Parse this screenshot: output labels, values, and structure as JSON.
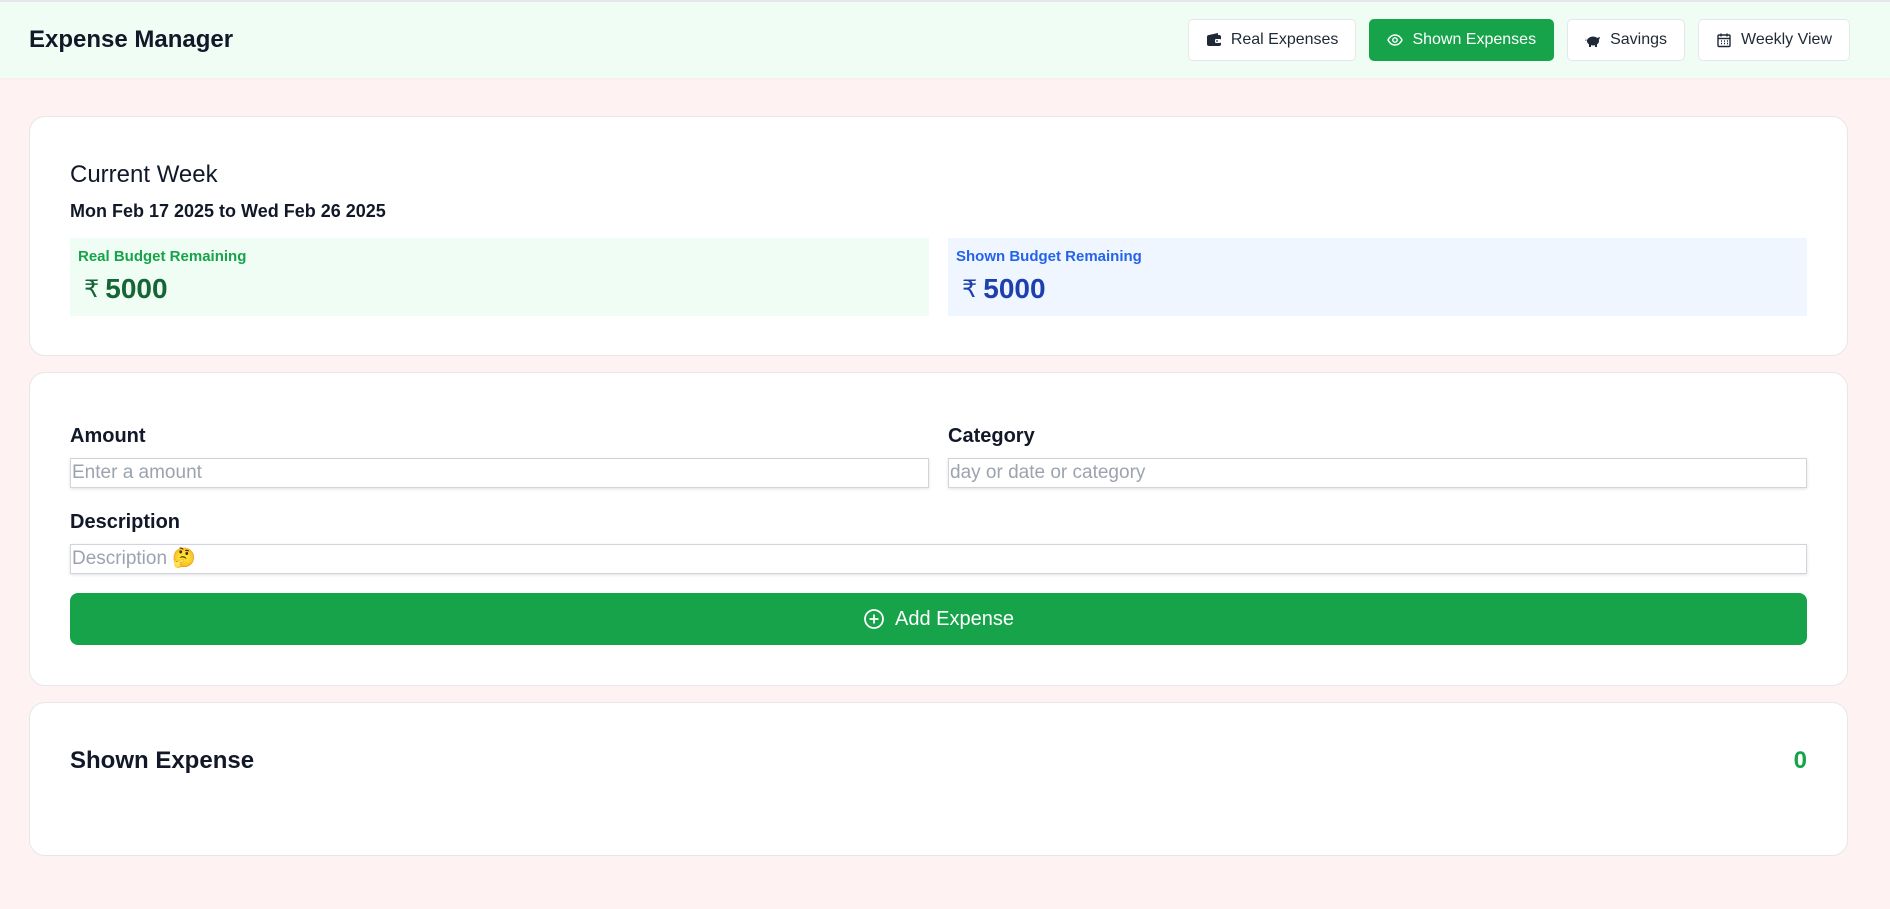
{
  "header": {
    "title": "Expense Manager",
    "nav": [
      {
        "label": "Real Expenses",
        "icon": "wallet-icon",
        "active": false
      },
      {
        "label": "Shown Expenses",
        "icon": "eye-icon",
        "active": true
      },
      {
        "label": "Savings",
        "icon": "piggy-bank-icon",
        "active": false
      },
      {
        "label": "Weekly View",
        "icon": "calendar-icon",
        "active": false
      }
    ]
  },
  "week": {
    "title": "Current Week",
    "range": "Mon Feb 17 2025 to  Wed Feb 26 2025",
    "real_budget": {
      "label": "Real Budget Remaining",
      "currency": "₹",
      "value": "5000"
    },
    "shown_budget": {
      "label": "Shown Budget Remaining",
      "currency": "₹",
      "value": "5000"
    }
  },
  "form": {
    "amount_label": "Amount",
    "amount_placeholder": "Enter a amount",
    "category_label": "Category",
    "category_placeholder": "day or date or category",
    "description_label": "Description",
    "description_placeholder": "Description 🤔",
    "submit_label": "Add Expense"
  },
  "shown_expense": {
    "title": "Shown Expense",
    "total": "0"
  },
  "colors": {
    "accent": "#16a34a",
    "page_bg": "#fef2f2",
    "header_bg": "#f0fdf4",
    "real_budget_bg": "#f0fdf4",
    "shown_budget_bg": "#eff6ff"
  }
}
